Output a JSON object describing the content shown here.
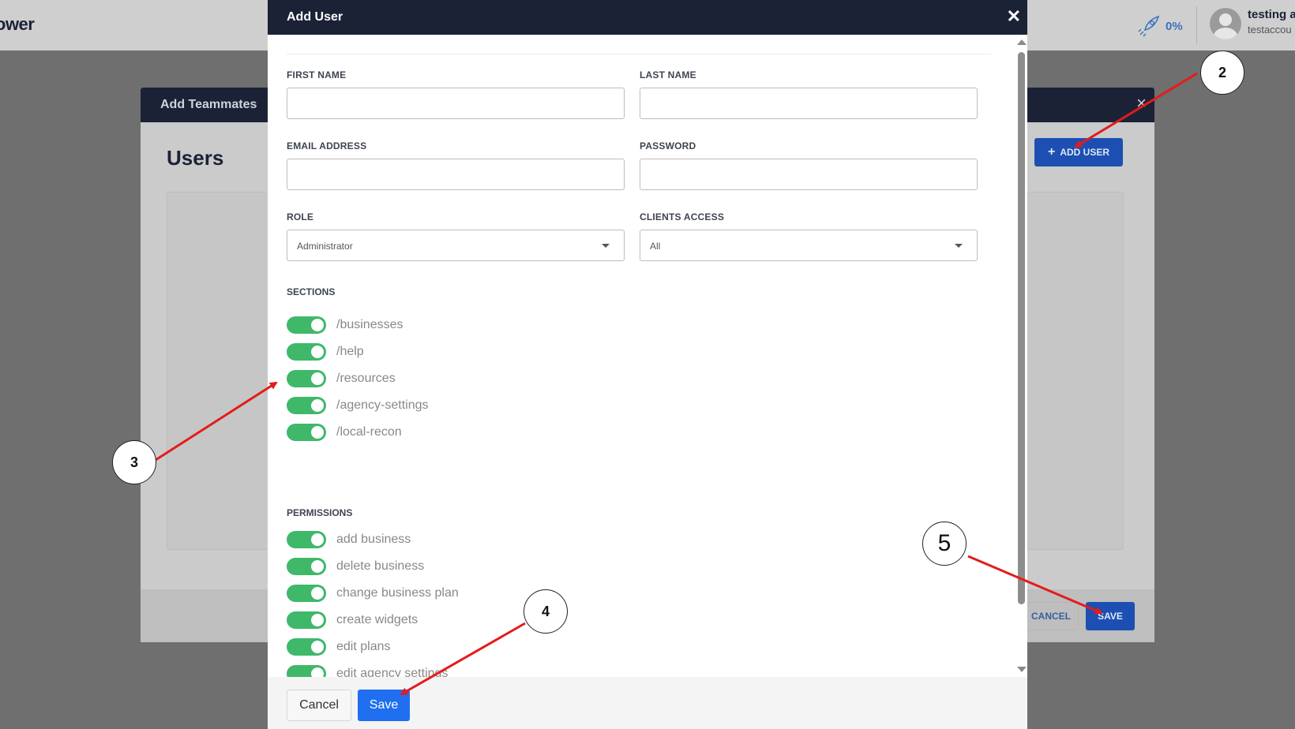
{
  "app": {
    "brand": "ower",
    "progress_percent": "0%",
    "user_name": "testing a",
    "user_sub": "testaccou"
  },
  "teammates": {
    "title": "Add Teammates",
    "close_glyph": "×",
    "heading": "Users",
    "add_user_label": "ADD USER",
    "cancel_label": "CANCEL",
    "save_label": "SAVE"
  },
  "add_user_modal": {
    "title": "Add User",
    "close_glyph": "✕",
    "fields": {
      "first_name_label": "FIRST NAME",
      "first_name_value": "",
      "last_name_label": "LAST NAME",
      "last_name_value": "",
      "email_label": "EMAIL ADDRESS",
      "email_value": "",
      "password_label": "PASSWORD",
      "password_value": "",
      "role_label": "ROLE",
      "role_value": "Administrator",
      "clients_access_label": "CLIENTS ACCESS",
      "clients_access_value": "All"
    },
    "sections_label": "SECTIONS",
    "sections": [
      {
        "label": "/businesses",
        "on": true
      },
      {
        "label": "/help",
        "on": true
      },
      {
        "label": "/resources",
        "on": true
      },
      {
        "label": "/agency-settings",
        "on": true
      },
      {
        "label": "/local-recon",
        "on": true
      }
    ],
    "permissions_label": "PERMISSIONS",
    "permissions": [
      {
        "label": "add business",
        "on": true
      },
      {
        "label": "delete business",
        "on": true
      },
      {
        "label": "change business plan",
        "on": true
      },
      {
        "label": "create widgets",
        "on": true
      },
      {
        "label": "edit plans",
        "on": true
      },
      {
        "label": "edit agency settings",
        "on": true
      }
    ],
    "cancel_label": "Cancel",
    "save_label": "Save"
  },
  "annotations": {
    "callout_2": "2",
    "callout_3": "3",
    "callout_4": "4",
    "callout_5": "5",
    "arrow_color": "#e41b1b"
  },
  "colors": {
    "navy": "#1b2236",
    "toggle_green": "#3fb86a",
    "primary_blue": "#1f6ff0"
  }
}
